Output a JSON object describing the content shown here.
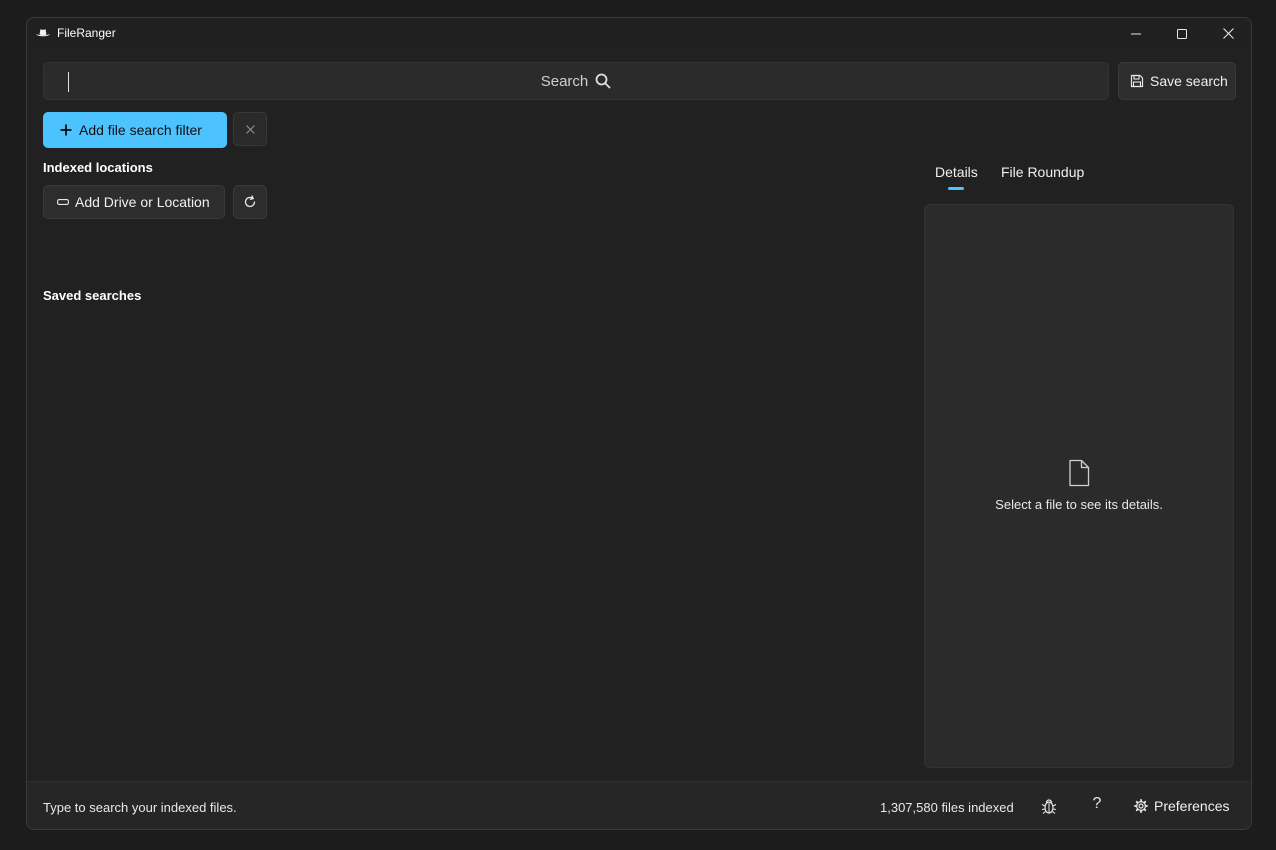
{
  "window": {
    "title": "FileRanger"
  },
  "search": {
    "placeholder": "Search"
  },
  "toolbar": {
    "save_search_label": "Save search",
    "add_filter_label": "Add file search filter"
  },
  "indexed_locations": {
    "title": "Indexed locations",
    "add_drive_label": "Add Drive or Location"
  },
  "saved_searches": {
    "title": "Saved searches"
  },
  "tabs": [
    {
      "label": "Details",
      "active": true
    },
    {
      "label": "File Roundup",
      "active": false
    }
  ],
  "details": {
    "empty_message": "Select a file to see its details."
  },
  "status": {
    "hint": "Type to search your indexed files.",
    "files_indexed": "1,307,580 files indexed",
    "help_label": "?",
    "preferences_label": "Preferences"
  },
  "colors": {
    "accent": "#4cc2ff",
    "background": "#212121",
    "panel": "#2b2b2b"
  },
  "icons": {
    "app": "cowboy-hat-icon",
    "search": "search-icon",
    "save": "floppy-disk-icon",
    "add": "plus-icon",
    "clear": "close-icon",
    "drive": "drive-icon",
    "refresh": "refresh-icon",
    "file": "file-icon",
    "bug": "bug-icon",
    "settings": "gear-icon"
  }
}
